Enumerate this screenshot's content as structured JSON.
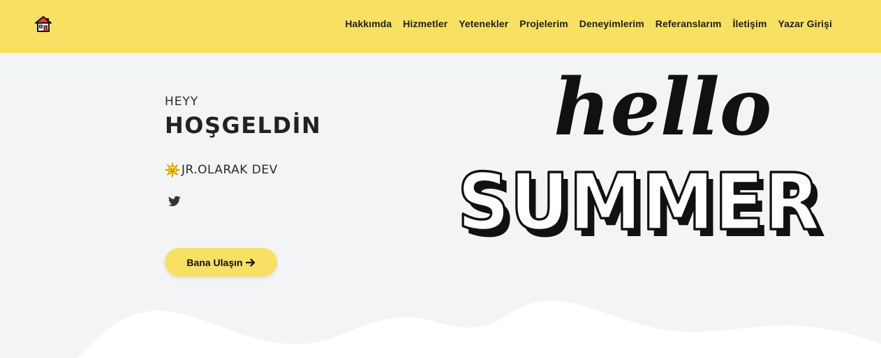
{
  "navbar": {
    "background": "#f7e062",
    "home_icon": "home-icon",
    "items": [
      {
        "label": "Hakkımda"
      },
      {
        "label": "Hizmetler"
      },
      {
        "label": "Yetenekler"
      },
      {
        "label": "Projelerim"
      },
      {
        "label": "Deneyimlerim"
      },
      {
        "label": "Referanslarım"
      },
      {
        "label": "İletişim"
      },
      {
        "label": "Yazar Girişi"
      }
    ]
  },
  "hero": {
    "greeting_small": "HEYY",
    "greeting_big": "HOŞGELDİN",
    "role_icon": "sun-icon",
    "role_text": "JR.OLARAK DEV",
    "social_icon": "twitter-icon",
    "cta_label": "Bana Ulaşın",
    "cta_icon": "arrow-right-icon",
    "art_word_script": "hello",
    "art_word_bubble": "SUMMER"
  },
  "colors": {
    "accent": "#f7e062",
    "page_background": "#f3f4f6",
    "wave": "#ffffff",
    "text": "#222222"
  }
}
